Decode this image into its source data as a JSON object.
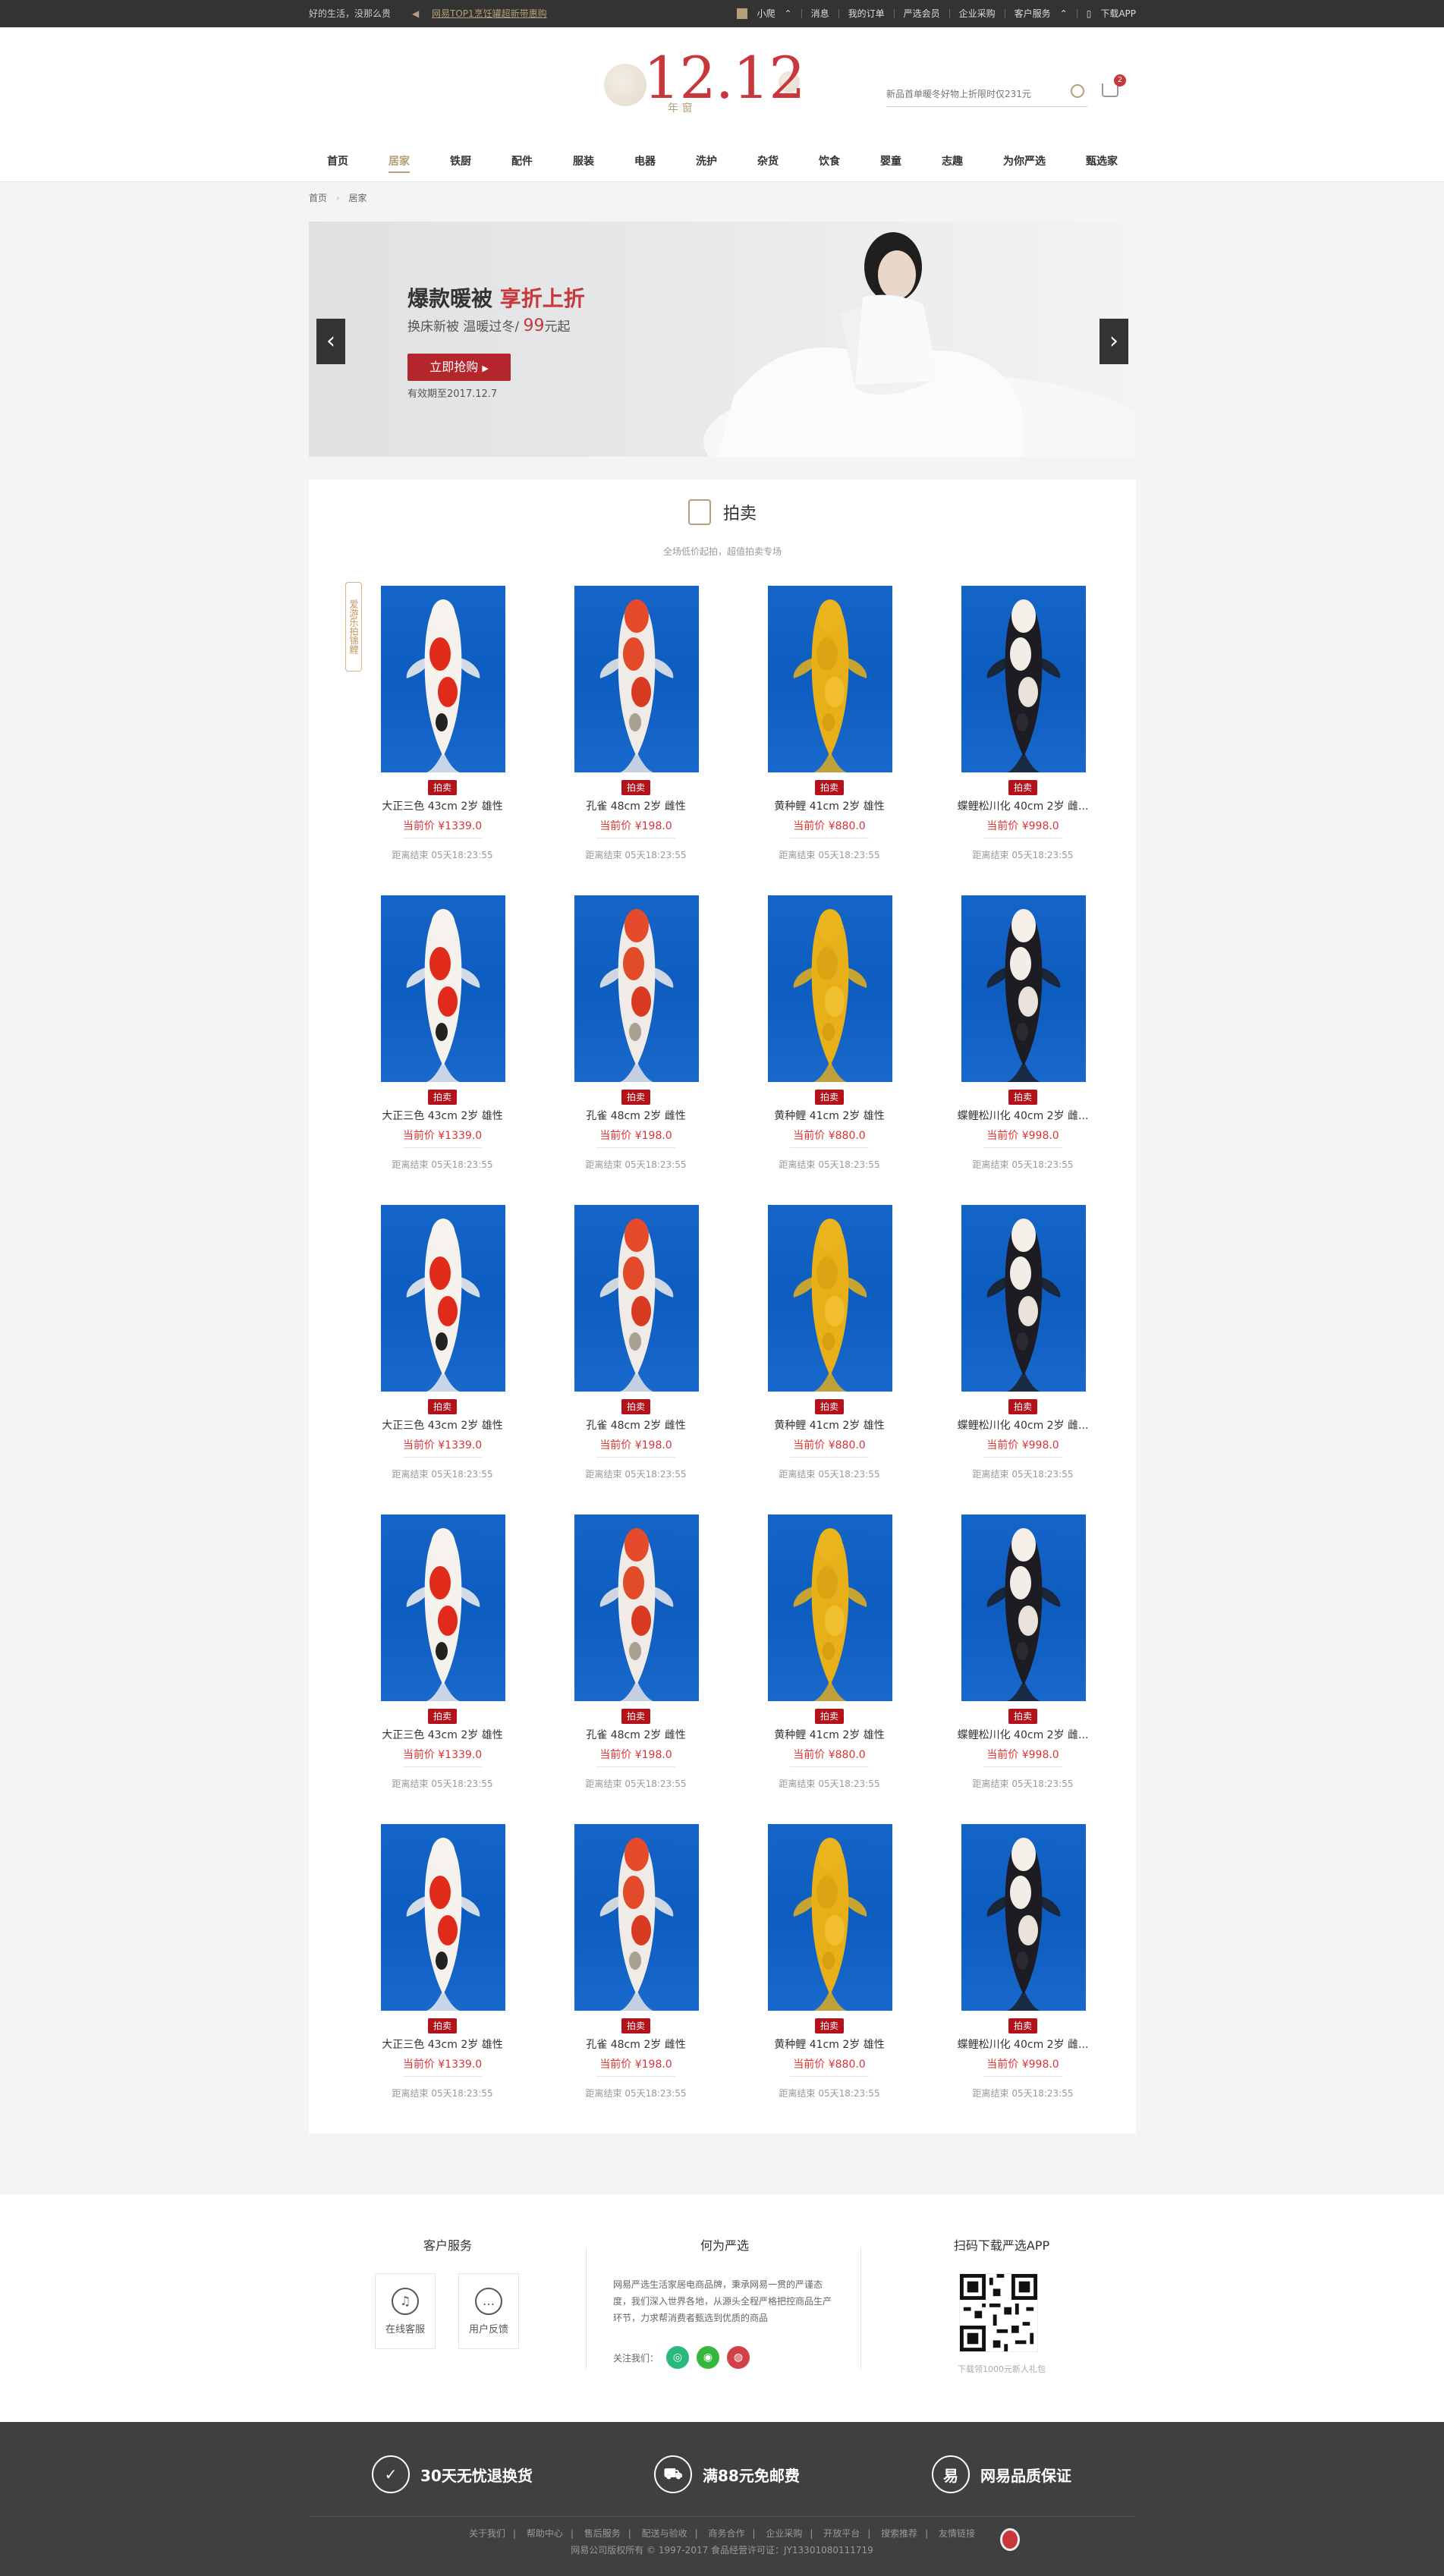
{
  "topbar": {
    "slogan": "好的生活，没那么贵",
    "notice": "网易TOP1烹饪罐超新带惠购",
    "links": [
      "小爬",
      "消息",
      "我的订单",
      "严选会员",
      "企业采购",
      "客户服务",
      "下载APP"
    ]
  },
  "header": {
    "logo": "12.12",
    "logo_sub": "年  窗",
    "search_placeholder": "新品首单暖冬好物上折限时仅231元",
    "cart_count": "2"
  },
  "nav": [
    "首页",
    "居家",
    "铁厨",
    "配件",
    "服装",
    "电器",
    "洗护",
    "杂货",
    "饮食",
    "婴童",
    "志趣",
    "为你严选",
    "甄选家"
  ],
  "breadcrumb": {
    "home": "首页",
    "current": "居家"
  },
  "banner": {
    "title_main": "爆款暖被",
    "title_accent": "享折上折",
    "sub_prefix": "换床新被 温暖过冬/",
    "sub_price": "99",
    "sub_suffix": "元起",
    "button": "立即抢购",
    "valid": "有效期至2017.12.7",
    "prev": "‹",
    "next": "›"
  },
  "section": {
    "title": "拍卖",
    "subtitle": "全场低价起拍，超值拍卖专场",
    "side_tag": "爱游乐拍锦鲤"
  },
  "products": [
    {
      "tag": "拍卖",
      "name": "大正三色 43cm 2岁 雄性",
      "price": "当前价 ¥1339.0",
      "end": "距离结束 05天18:23:55",
      "fish": "sanke"
    },
    {
      "tag": "拍卖",
      "name": "孔雀 48cm 2岁 雌性",
      "price": "当前价 ¥198.0",
      "end": "距离结束 05天18:23:55",
      "fish": "kujaku"
    },
    {
      "tag": "拍卖",
      "name": "黄种鲤 41cm 2岁 雄性",
      "price": "当前价 ¥880.0",
      "end": "距离结束 05天18:23:55",
      "fish": "yamabuki"
    },
    {
      "tag": "拍卖",
      "name": "蝶鲤松川化 40cm 2岁 雌...",
      "price": "当前价 ¥998.0",
      "end": "距离结束 05天18:23:55",
      "fish": "matsukawa"
    }
  ],
  "footer": {
    "service_title": "客户服务",
    "service_items": [
      {
        "label": "在线客服",
        "icon": "headset-icon"
      },
      {
        "label": "用户反馈",
        "icon": "chat-icon"
      }
    ],
    "about_title": "何为严选",
    "about_text": "网易严选生活家居电商品牌，秉承网易一贯的严谨态度，我们深入世界各地，从源头全程严格把控商品生产环节，力求帮消费者甄选到优质的商品",
    "follow_label": "关注我们：",
    "app_title": "扫码下载严选APP",
    "app_sub": "下载领1000元新人礼包",
    "promises": [
      "30天无忧退换货",
      "满88元免邮费",
      "网易品质保证"
    ],
    "links": [
      "关于我们",
      "帮助中心",
      "售后服务",
      "配送与验收",
      "商务合作",
      "企业采购",
      "开放平台",
      "搜索推荐",
      "友情链接"
    ],
    "copyright": "网易公司版权所有 © 1997-2017   食品经营许可证：JY13301080111719"
  }
}
